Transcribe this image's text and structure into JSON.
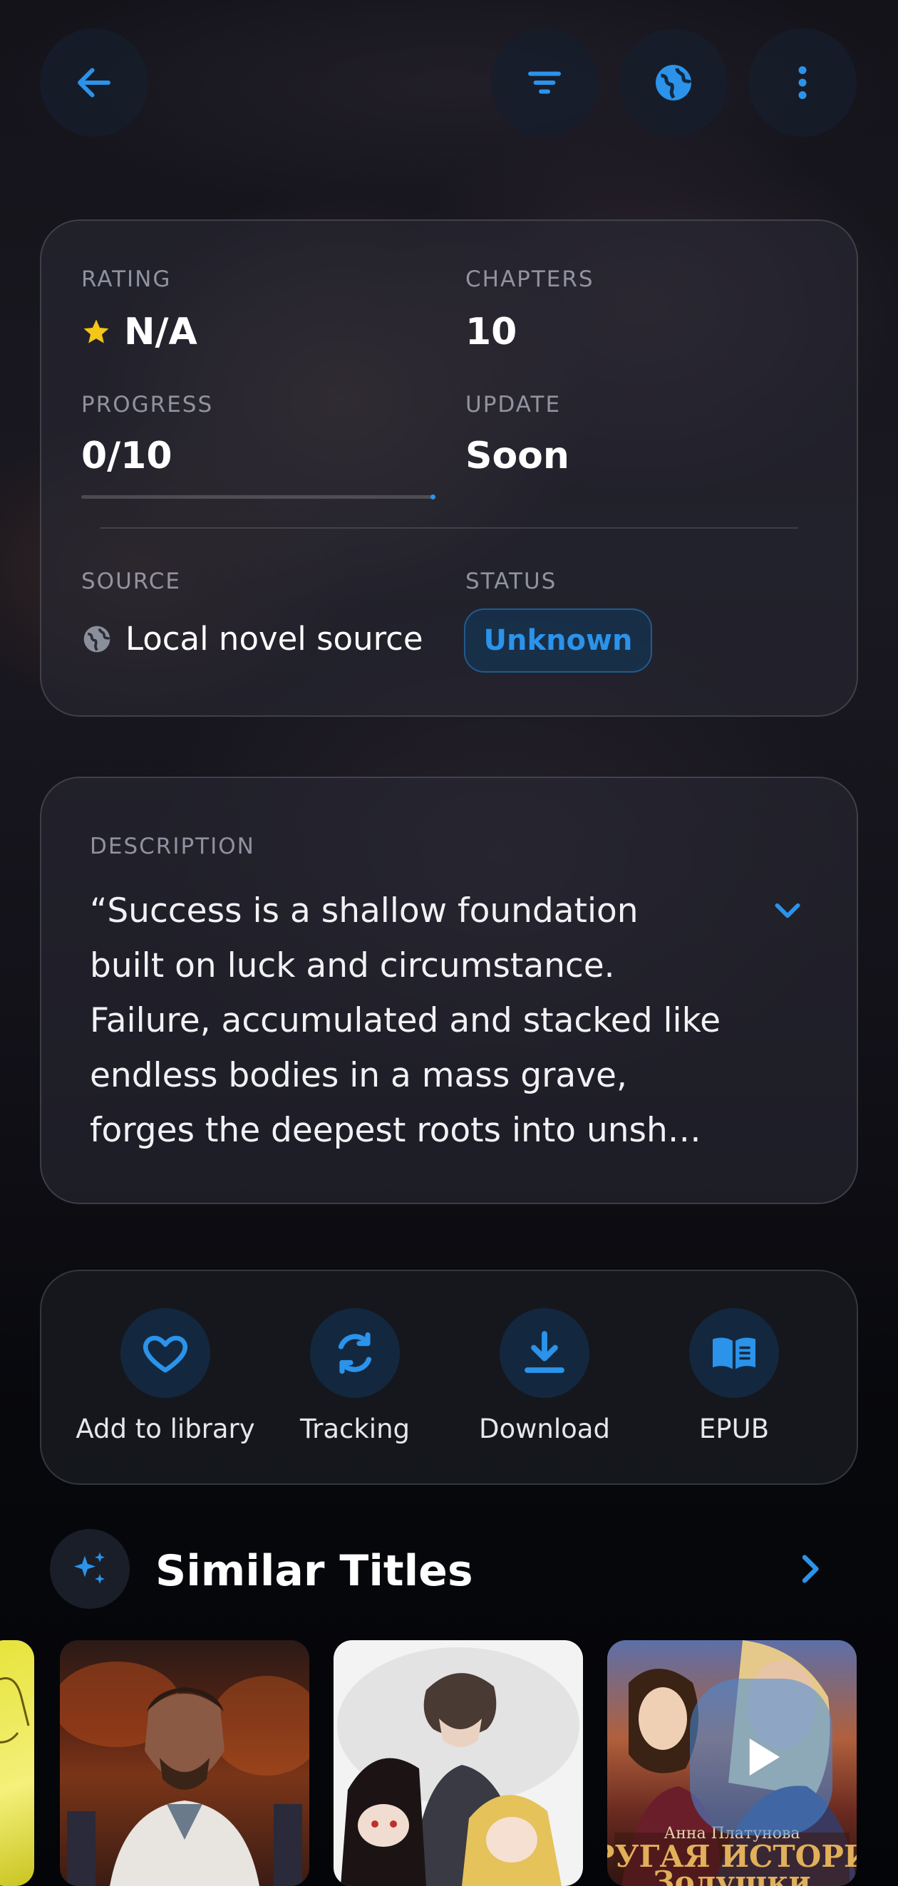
{
  "topbar": {
    "back_icon": "arrow-left-icon",
    "filter_icon": "filter-icon",
    "web_icon": "globe-icon",
    "more_icon": "more-vertical-icon"
  },
  "stats": {
    "rating_label": "RATING",
    "rating_value": "N/A",
    "chapters_label": "CHAPTERS",
    "chapters_value": "10",
    "progress_label": "PROGRESS",
    "progress_value": "0/10",
    "progress_fraction": 0,
    "update_label": "UPDATE",
    "update_value": "Soon",
    "source_label": "SOURCE",
    "source_value": "Local novel source",
    "status_label": "STATUS",
    "status_value": "Unknown"
  },
  "description": {
    "label": "DESCRIPTION",
    "lines": [
      "“Success is a shallow foundation",
      "built on luck and circumstance.",
      "Failure, accumulated and stacked like",
      "endless bodies in a mass grave,",
      "forges the deepest roots into unsh…"
    ]
  },
  "actions": {
    "add_library": "Add to library",
    "tracking": "Tracking",
    "download": "Download",
    "epub": "EPUB"
  },
  "similar": {
    "title": "Similar Titles"
  },
  "colors": {
    "accent": "#2b93ea",
    "star": "#f5c518"
  }
}
